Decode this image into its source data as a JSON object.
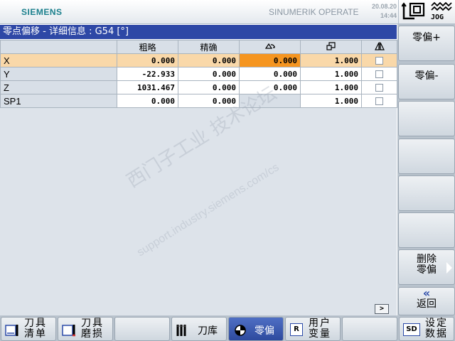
{
  "header": {
    "brand": "SIEMENS",
    "product": "SINUMERIK OPERATE",
    "date": "20.08.20",
    "time": "14:44",
    "jog_label": "JOG"
  },
  "title": "零点偏移 - 详细信息 : G54 [°]",
  "table": {
    "columns": [
      "",
      "粗略",
      "精确",
      "rotation-icon",
      "scale-icon",
      "mirror-icon"
    ],
    "rows": [
      {
        "axis": "X",
        "coarse": "0.000",
        "fine": "0.000",
        "rotation": "0.000",
        "scale": "1.000",
        "mirror": false,
        "selected": true
      },
      {
        "axis": "Y",
        "coarse": "-22.933",
        "fine": "0.000",
        "rotation": "0.000",
        "scale": "1.000",
        "mirror": false,
        "selected": false
      },
      {
        "axis": "Z",
        "coarse": "1031.467",
        "fine": "0.000",
        "rotation": "0.000",
        "scale": "1.000",
        "mirror": false,
        "selected": false
      },
      {
        "axis": "SP1",
        "coarse": "0.000",
        "fine": "0.000",
        "rotation": "",
        "scale": "1.000",
        "mirror": false,
        "selected": false
      }
    ]
  },
  "scroll_button": ">",
  "watermark": {
    "cn": "西门子工业  技术论坛",
    "url": "support.industry.siemens.com/cs"
  },
  "vertical_softkeys": [
    {
      "label": "零偏+"
    },
    {
      "label": "零偏-"
    },
    {
      "label": ""
    },
    {
      "label": ""
    },
    {
      "label": ""
    },
    {
      "label": ""
    },
    {
      "label_line1": "删除",
      "label_line2": "零偏"
    },
    {
      "back_arrow": "«",
      "label": "返回"
    }
  ],
  "horizontal_softkeys": [
    {
      "line1": "刀具",
      "line2": "清单",
      "icon": "tool-list-icon"
    },
    {
      "line1": "刀具",
      "line2": "磨损",
      "icon": "tool-wear-icon"
    },
    {
      "label": ""
    },
    {
      "label": "刀库",
      "icon": "magazine-icon"
    },
    {
      "label": "零偏",
      "icon": "work-offset-icon",
      "active": true
    },
    {
      "line1": "用户",
      "line2": "变量",
      "icon": "user-variable-icon",
      "icon_text": "R"
    },
    {
      "label": ""
    },
    {
      "line1": "设定",
      "line2": "数据",
      "icon": "setting-data-icon",
      "icon_text": "SD"
    }
  ],
  "colors": {
    "title_bar": "#2e48a6",
    "selected_row": "#f9d8a9",
    "focus_cell": "#f59520",
    "brand": "#1a7f8c"
  }
}
